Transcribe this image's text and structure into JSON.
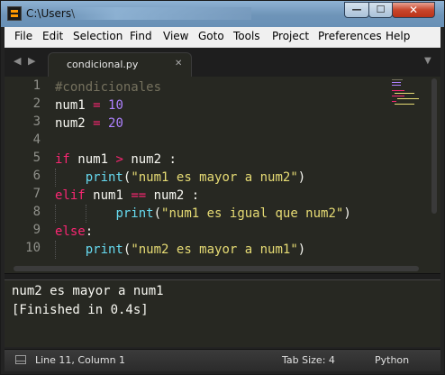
{
  "window": {
    "title": "C:\\Users\\",
    "min_glyph": "—",
    "max_glyph": "☐",
    "close_glyph": "✕"
  },
  "menu": [
    "File",
    "Edit",
    "Selection",
    "Find",
    "View",
    "Goto",
    "Tools",
    "Project",
    "Preferences",
    "Help"
  ],
  "tabs": {
    "left_arrow": "◀",
    "right_arrow": "▶",
    "active_tab": "condicional.py",
    "close": "✕",
    "dropdown": "▼"
  },
  "editor": {
    "line_numbers": [
      "1",
      "2",
      "3",
      "4",
      "5",
      "6",
      "7",
      "8",
      "9",
      "10"
    ],
    "code": {
      "l1_comment": "#condicionales",
      "l2_var": "num1",
      "l2_op": "=",
      "l2_num": "10",
      "l3_var": "num2",
      "l3_op": "=",
      "l3_num": "20",
      "l5_kw": "if",
      "l5_a": "num1",
      "l5_op": ">",
      "l5_b": "num2 :",
      "l6_fn": "print",
      "l6_p1": "(",
      "l6_str": "\"num1 es mayor a num2\"",
      "l6_p2": ")",
      "l7_kw": "elif",
      "l7_a": "num1",
      "l7_op": "==",
      "l7_b": "num2 :",
      "l8_fn": "print",
      "l8_p1": "(",
      "l8_str": "\"num1 es igual que num2\"",
      "l8_p2": ")",
      "l9_kw": "else",
      "l9_colon": ":",
      "l10_fn": "print",
      "l10_p1": "(",
      "l10_str": "\"num2 es mayor a num1\"",
      "l10_p2": ")"
    }
  },
  "output": {
    "lines": [
      "num2 es mayor a num1",
      "[Finished in 0.4s]"
    ]
  },
  "status": {
    "position": "Line 11, Column 1",
    "tab_size": "Tab Size: 4",
    "syntax": "Python"
  },
  "colors": {
    "background": "#272822",
    "keyword": "#f92672",
    "function": "#66d9ef",
    "string": "#e6db74",
    "number": "#ae81ff",
    "comment": "#75715e"
  }
}
